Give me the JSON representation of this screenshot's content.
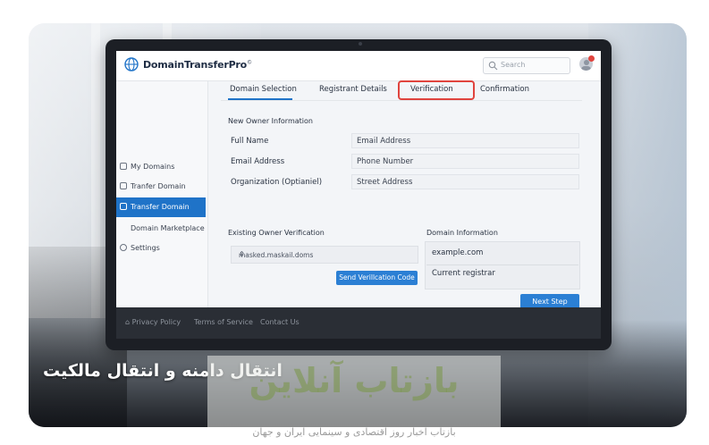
{
  "app": {
    "brand": "DomainTransferPro",
    "brand_mark": "©",
    "search_placeholder": "Search"
  },
  "sidebar": {
    "items": [
      {
        "label": "My Domains",
        "active": false
      },
      {
        "label": "Tranfer Domain",
        "active": false
      },
      {
        "label": "Transfer Domain",
        "active": true
      },
      {
        "label": "Domain Marketplace",
        "active": false
      },
      {
        "label": "Settings",
        "active": false
      }
    ]
  },
  "tabs": [
    {
      "label": "Domain Selection",
      "active": true
    },
    {
      "label": "Registrant Details",
      "active": false
    },
    {
      "label": "Verification",
      "highlighted": true
    },
    {
      "label": "Confirmation",
      "active": false
    }
  ],
  "new_owner": {
    "title": "New Owner Information",
    "rows": [
      {
        "label": "Full Name",
        "value": "Email Address"
      },
      {
        "label": "Email Address",
        "value": "Phone Number"
      },
      {
        "label": "Organization (Optianiel)",
        "value": "Street Address"
      }
    ]
  },
  "existing_owner": {
    "title": "Existing Owner Verification",
    "select_value": "masked.maskail.doms",
    "send_button": "Send Verillcation Code"
  },
  "domain_info": {
    "title": "Domain Information",
    "domain": "example.com",
    "registrar": "Current registrar"
  },
  "next_button": "Next Step",
  "footer": {
    "links": [
      "Privacy Policy",
      "Terms of Service",
      "Contact Us"
    ]
  },
  "overlay": {
    "caption": "انتقال دامنه و انتقال مالکیت",
    "watermark": "بازتاب آنلاین",
    "watermark_sub": "بازتاب اخبار روز اقتصادی و سینمایی ایران و جهان"
  },
  "colors": {
    "accent": "#1f73c8",
    "highlight": "#e0443e",
    "button": "#2b7fd4"
  }
}
